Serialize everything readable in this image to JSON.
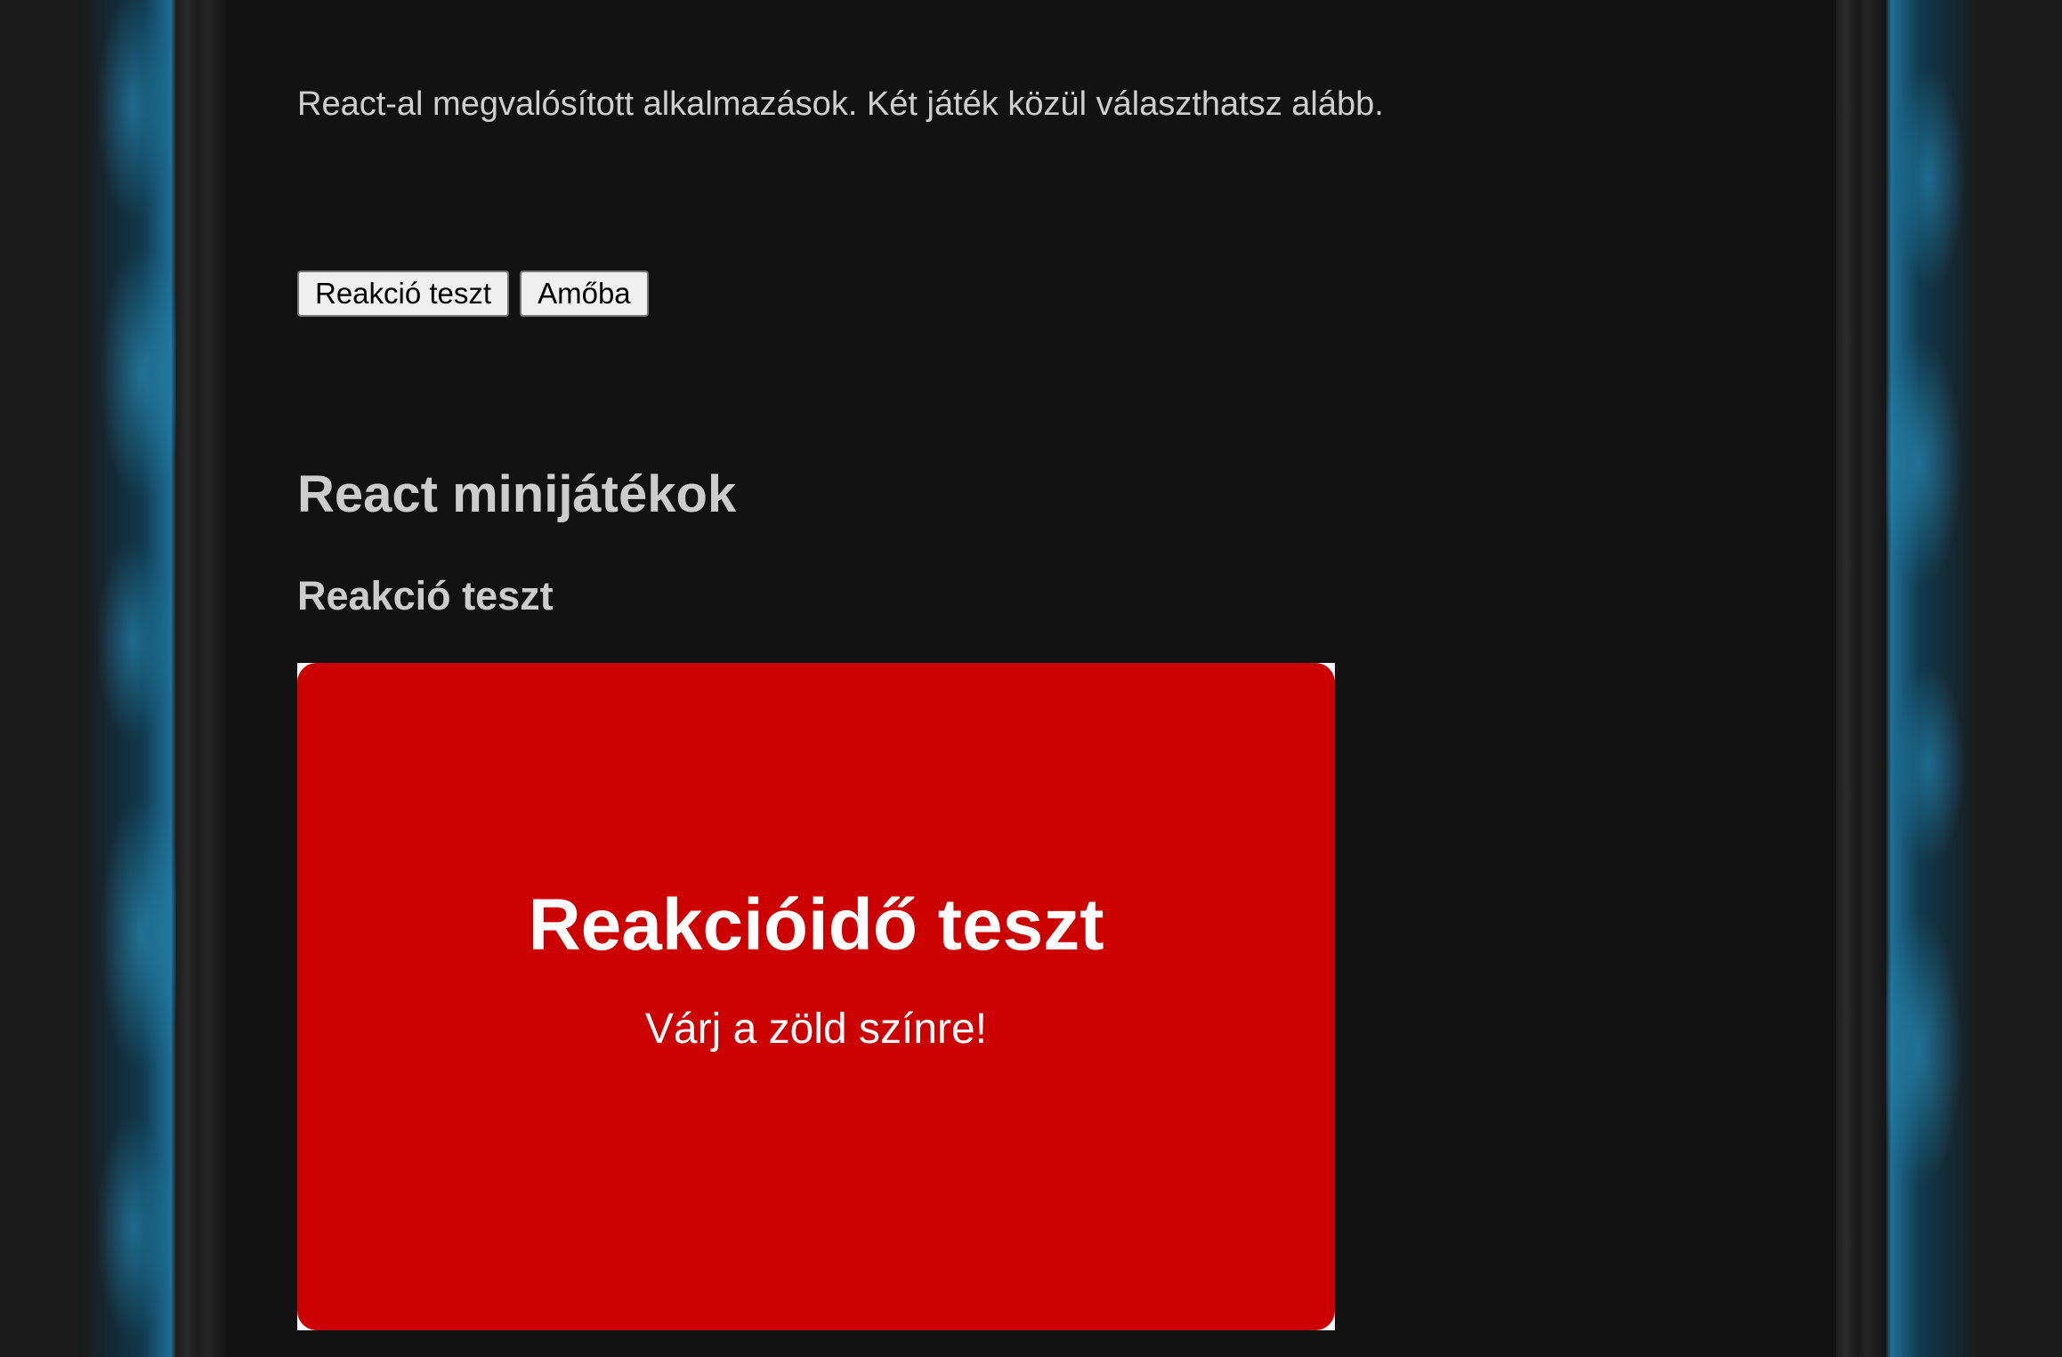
{
  "intro_text": "React-al megvalósított alkalmazások. Két játék közül választhatsz alább.",
  "game_buttons": [
    {
      "label": "Reakció teszt"
    },
    {
      "label": "Amőba"
    }
  ],
  "page_title": "React minijátékok",
  "section_title": "Reakció teszt",
  "game": {
    "title": "Reakcióidő teszt",
    "subtitle": "Várj a zöld színre!",
    "panel_color": "#cc0000"
  },
  "colors": {
    "background": "#121212",
    "text": "#cccccc",
    "accent_border": "#1e6f96"
  }
}
